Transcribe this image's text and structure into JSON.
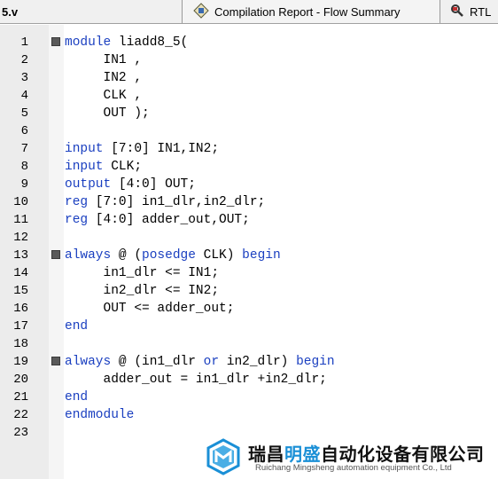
{
  "tabs": {
    "file": "5.v",
    "report": "Compilation Report - Flow Summary",
    "rtl": "RTL"
  },
  "colors": {
    "keyword": "#1a3fc0",
    "gutter": "#ececec",
    "brand": "#1a8fd6"
  },
  "editor": {
    "lines": [
      {
        "num": "1",
        "fold": true,
        "segs": [
          {
            "k": true,
            "t": "module"
          },
          {
            "k": false,
            "t": " liadd8_5("
          }
        ]
      },
      {
        "num": "2",
        "fold": false,
        "segs": [
          {
            "k": false,
            "t": "     IN1 ,"
          }
        ]
      },
      {
        "num": "3",
        "fold": false,
        "segs": [
          {
            "k": false,
            "t": "     IN2 ,"
          }
        ]
      },
      {
        "num": "4",
        "fold": false,
        "segs": [
          {
            "k": false,
            "t": "     CLK ,"
          }
        ]
      },
      {
        "num": "5",
        "fold": false,
        "segs": [
          {
            "k": false,
            "t": "     OUT );"
          }
        ]
      },
      {
        "num": "6",
        "fold": false,
        "segs": []
      },
      {
        "num": "7",
        "fold": false,
        "segs": [
          {
            "k": true,
            "t": "input"
          },
          {
            "k": false,
            "t": " [7:0] IN1,IN2;"
          }
        ]
      },
      {
        "num": "8",
        "fold": false,
        "segs": [
          {
            "k": true,
            "t": "input"
          },
          {
            "k": false,
            "t": " CLK;"
          }
        ]
      },
      {
        "num": "9",
        "fold": false,
        "segs": [
          {
            "k": true,
            "t": "output"
          },
          {
            "k": false,
            "t": " [4:0] OUT;"
          }
        ]
      },
      {
        "num": "10",
        "fold": false,
        "segs": [
          {
            "k": true,
            "t": "reg"
          },
          {
            "k": false,
            "t": " [7:0] in1_dlr,in2_dlr;"
          }
        ]
      },
      {
        "num": "11",
        "fold": false,
        "segs": [
          {
            "k": true,
            "t": "reg"
          },
          {
            "k": false,
            "t": " [4:0] adder_out,OUT;"
          }
        ]
      },
      {
        "num": "12",
        "fold": false,
        "segs": []
      },
      {
        "num": "13",
        "fold": true,
        "segs": [
          {
            "k": true,
            "t": "always"
          },
          {
            "k": false,
            "t": " @ ("
          },
          {
            "k": true,
            "t": "posedge"
          },
          {
            "k": false,
            "t": " CLK) "
          },
          {
            "k": true,
            "t": "begin"
          }
        ]
      },
      {
        "num": "14",
        "fold": false,
        "segs": [
          {
            "k": false,
            "t": "     in1_dlr <= IN1;"
          }
        ]
      },
      {
        "num": "15",
        "fold": false,
        "segs": [
          {
            "k": false,
            "t": "     in2_dlr <= IN2;"
          }
        ]
      },
      {
        "num": "16",
        "fold": false,
        "segs": [
          {
            "k": false,
            "t": "     OUT <= adder_out;"
          }
        ]
      },
      {
        "num": "17",
        "fold": false,
        "segs": [
          {
            "k": true,
            "t": "end"
          }
        ]
      },
      {
        "num": "18",
        "fold": false,
        "segs": []
      },
      {
        "num": "19",
        "fold": true,
        "segs": [
          {
            "k": true,
            "t": "always"
          },
          {
            "k": false,
            "t": " @ (in1_dlr "
          },
          {
            "k": true,
            "t": "or"
          },
          {
            "k": false,
            "t": " in2_dlr) "
          },
          {
            "k": true,
            "t": "begin"
          }
        ]
      },
      {
        "num": "20",
        "fold": false,
        "segs": [
          {
            "k": false,
            "t": "     adder_out = in1_dlr +in2_dlr;"
          }
        ]
      },
      {
        "num": "21",
        "fold": false,
        "segs": [
          {
            "k": true,
            "t": "end"
          }
        ]
      },
      {
        "num": "22",
        "fold": false,
        "segs": [
          {
            "k": true,
            "t": "endmodule"
          }
        ]
      },
      {
        "num": "23",
        "fold": false,
        "segs": []
      }
    ]
  },
  "watermark": {
    "cn_prefix": "瑞昌",
    "cn_highlight": "明盛",
    "cn_suffix": "自动化设备有限公司",
    "en": "Ruichang Mingsheng automation equipment Co., Ltd"
  }
}
